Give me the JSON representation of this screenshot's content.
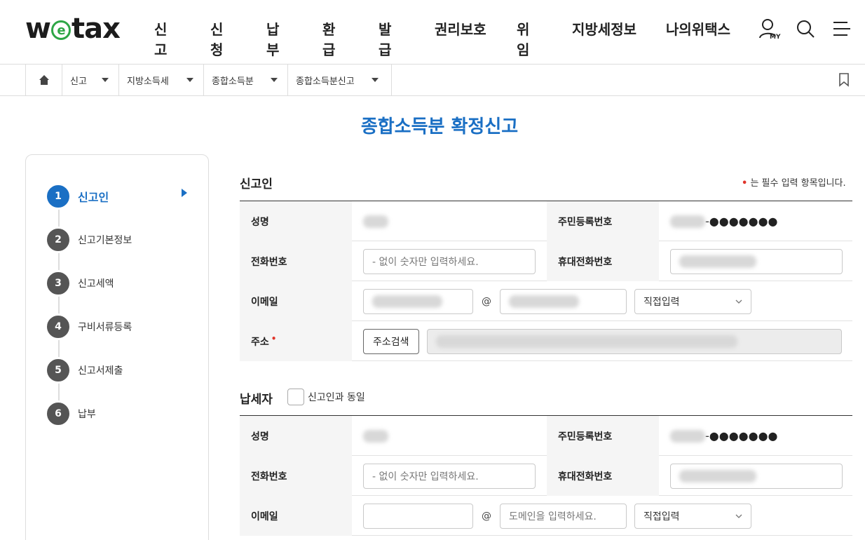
{
  "header": {
    "logo": {
      "w": "w",
      "e": "e",
      "tax": "tax"
    },
    "nav": [
      "신고",
      "신청",
      "납부",
      "환급",
      "발급",
      "권리보호",
      "위임",
      "지방세정보",
      "나의위택스"
    ],
    "my_label": "MY"
  },
  "breadcrumb": [
    "신고",
    "지방소득세",
    "종합소득분",
    "종합소득분신고"
  ],
  "page_title": "종합소득분 확정신고",
  "steps": [
    {
      "num": "1",
      "label": "신고인"
    },
    {
      "num": "2",
      "label": "신고기본정보"
    },
    {
      "num": "3",
      "label": "신고세액"
    },
    {
      "num": "4",
      "label": "구비서류등록"
    },
    {
      "num": "5",
      "label": "신고서제출"
    },
    {
      "num": "6",
      "label": "납부"
    }
  ],
  "reporter": {
    "title": "신고인",
    "required_note": "는 필수 입력 항목입니다.",
    "name_label": "성명",
    "rrn_label": "주민등록번호",
    "rrn_mask": "-●●●●●●●",
    "phone_label": "전화번호",
    "phone_placeholder": "- 없이 숫자만 입력하세요.",
    "mobile_label": "휴대전화번호",
    "email_label": "이메일",
    "at": "@",
    "domain_select": "직접입력",
    "address_label": "주소",
    "address_button": "주소검색"
  },
  "taxpayer": {
    "title": "납세자",
    "same_as_label": "신고인과 동일",
    "name_label": "성명",
    "rrn_label": "주민등록번호",
    "rrn_mask": "-●●●●●●●",
    "phone_label": "전화번호",
    "phone_placeholder": "- 없이 숫자만 입력하세요.",
    "mobile_label": "휴대전화번호",
    "email_label": "이메일",
    "at": "@",
    "domain_placeholder": "도메인을 입력하세요.",
    "domain_select": "직접입력"
  },
  "colors": {
    "brand_blue": "#1a6fc4",
    "logo_green": "#2ea646",
    "required_red": "#e0352b"
  }
}
